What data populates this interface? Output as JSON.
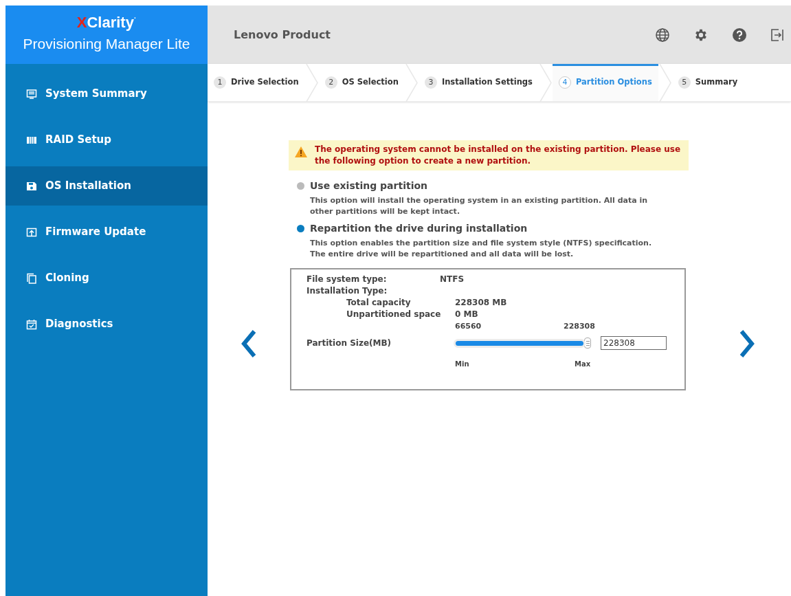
{
  "logo": {
    "brand_x": "X",
    "brand_rest": "Clarity",
    "trademark": "·",
    "product": "Provisioning Manager Lite"
  },
  "header": {
    "title": "Lenovo Product"
  },
  "sidebar": {
    "items": [
      {
        "label": "System Summary",
        "selected": false
      },
      {
        "label": "RAID Setup",
        "selected": false
      },
      {
        "label": "OS Installation",
        "selected": true
      },
      {
        "label": "Firmware Update",
        "selected": false
      },
      {
        "label": "Cloning",
        "selected": false
      },
      {
        "label": "Diagnostics",
        "selected": false
      }
    ]
  },
  "steps": [
    {
      "number": "1",
      "label": "Drive Selection",
      "selected": false
    },
    {
      "number": "2",
      "label": "OS Selection",
      "selected": false
    },
    {
      "number": "3",
      "label": "Installation Settings",
      "selected": false
    },
    {
      "number": "4",
      "label": "Partition Options",
      "selected": true
    },
    {
      "number": "5",
      "label": "Summary",
      "selected": false
    }
  ],
  "warning": "The operating system cannot be installed on the existing partition. Please use the following option to create a new partition.",
  "options": [
    {
      "label": "Use existing partition",
      "description": "This option will install the operating system in an existing partition. All data in other partitions will be kept intact.",
      "selected": false
    },
    {
      "label": "Repartition the drive during installation",
      "description": "This option enables the partition size and file system style (NTFS) specification. The entire drive will be repartitioned and all data will be lost.",
      "selected": true
    }
  ],
  "details": {
    "file_system_label": "File system type:",
    "file_system_value": "NTFS",
    "installation_type_label": "Installation Type:",
    "rows": [
      {
        "label": "Total capacity",
        "value": "228308 MB"
      },
      {
        "label": "Unpartitioned space",
        "value": "0 MB"
      }
    ]
  },
  "partition_size": {
    "label": "Partition Size(MB)",
    "min_value": "66560",
    "max_value": "228308",
    "min_label": "Min",
    "max_label": "Max",
    "level": 1,
    "value": "228308"
  }
}
